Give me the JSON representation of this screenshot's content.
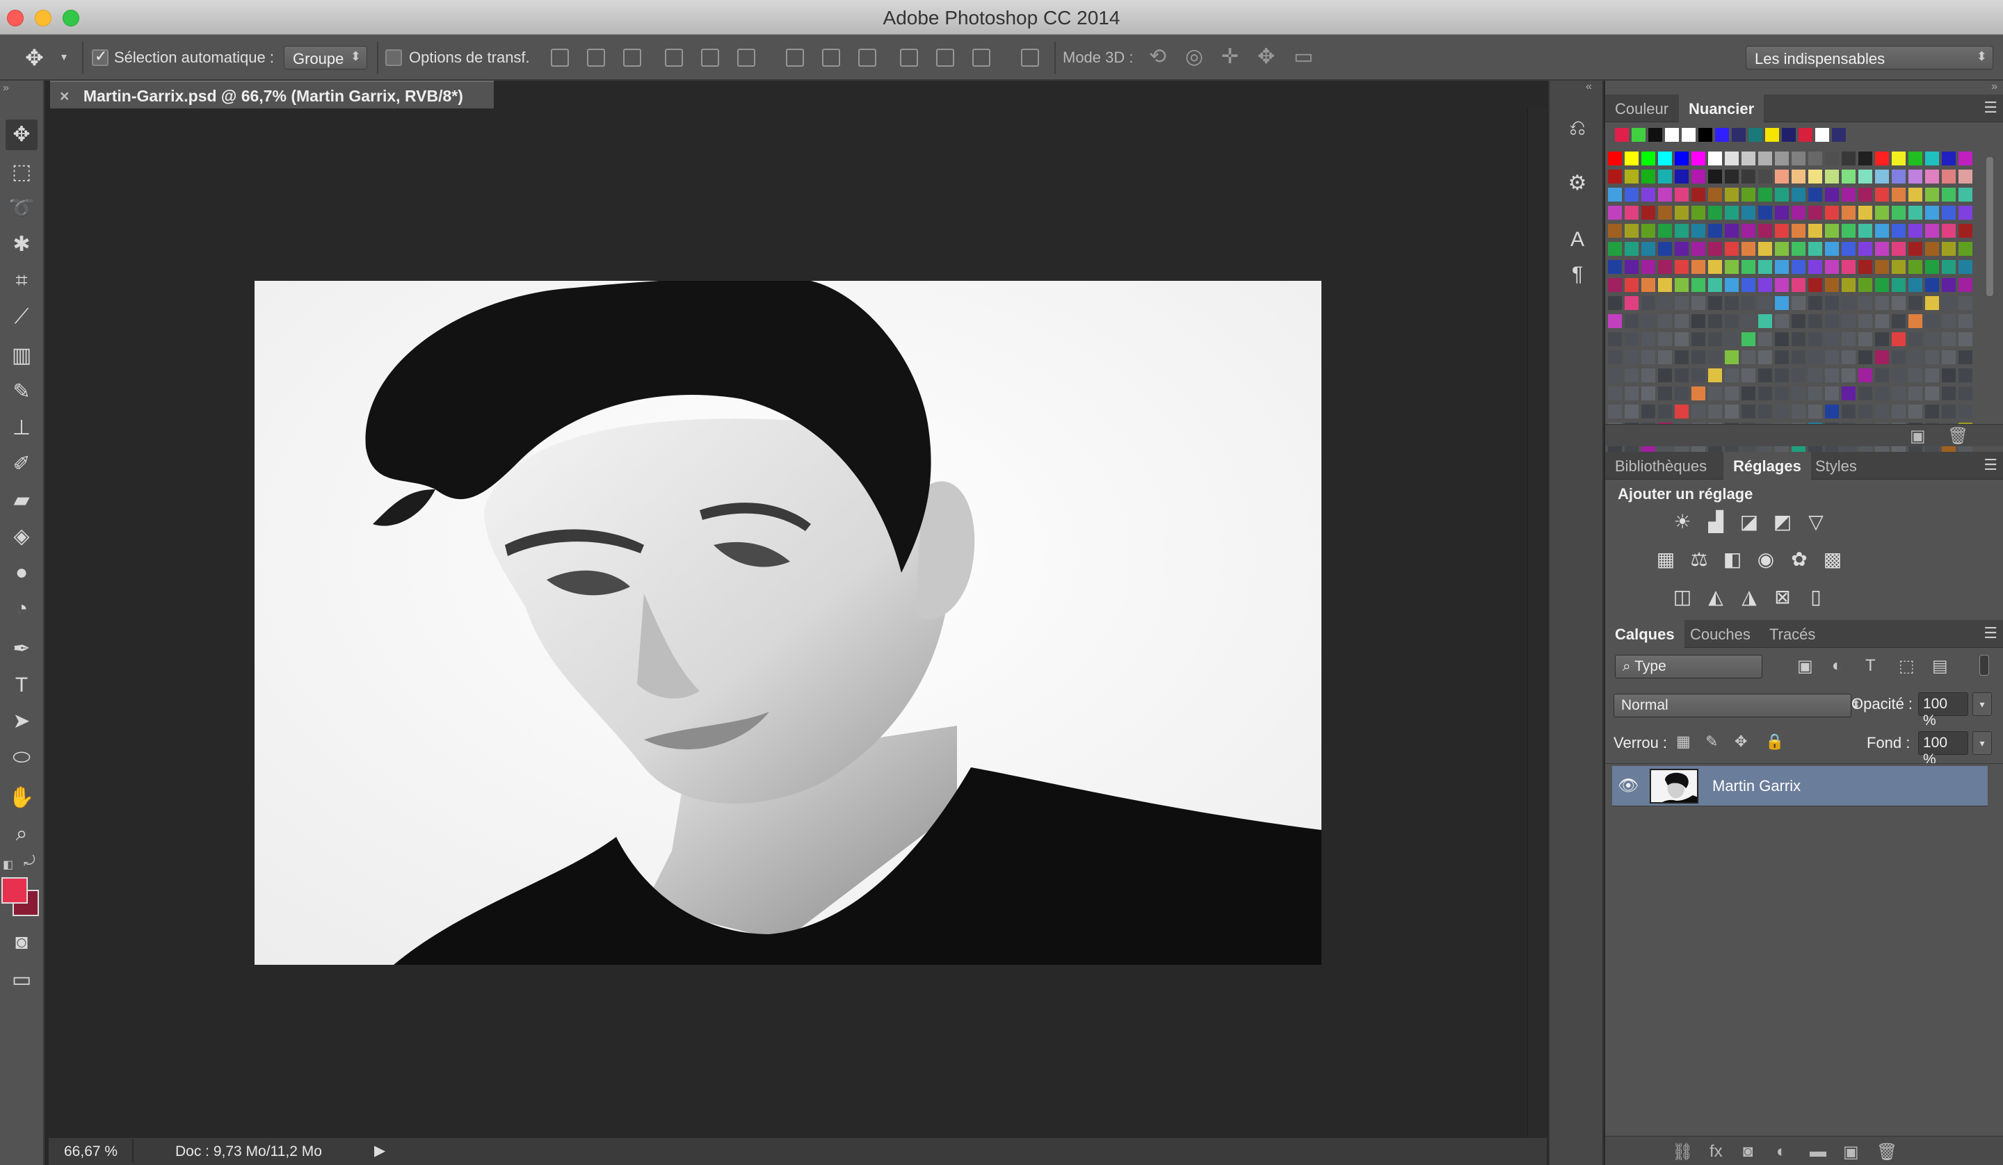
{
  "window": {
    "title": "Adobe Photoshop CC 2014"
  },
  "options_bar": {
    "auto_select_label": "Sélection automatique :",
    "auto_select_value": "Groupe",
    "transform_label": "Options de transf.",
    "mode3d_label": "Mode 3D :",
    "workspace_value": "Les indispensables"
  },
  "document": {
    "tab_title": "Martin-Garrix.psd @ 66,7% (Martin Garrix, RVB/8*)"
  },
  "status": {
    "zoom": "66,67 %",
    "doc_info": "Doc : 9,73 Mo/11,2 Mo"
  },
  "panels": {
    "color_tabs": [
      "Couleur",
      "Nuancier"
    ],
    "adjust_tabs": [
      "Bibliothèques",
      "Réglages",
      "Styles"
    ],
    "adjust_title": "Ajouter un réglage",
    "layers_tabs": [
      "Calques",
      "Couches",
      "Tracés"
    ],
    "filter_type": "Type",
    "blend_mode": "Normal",
    "opacity_label": "Opacité :",
    "opacity_value": "100 %",
    "lock_label": "Verrou :",
    "fill_label": "Fond :",
    "fill_value": "100 %",
    "layer_name": "Martin Garrix"
  },
  "colors": {
    "foreground": "#e8304f",
    "background": "#8a1b34",
    "recent_swatches": [
      "#e0204a",
      "#40d040",
      "#101010",
      "#ffffff",
      "#ffffff",
      "#000000",
      "#3020ff",
      "#2d2d6b",
      "#1a7a7a",
      "#f4e400",
      "#20206a",
      "#d8203c",
      "#ffffff",
      "#2e2e6e"
    ]
  }
}
